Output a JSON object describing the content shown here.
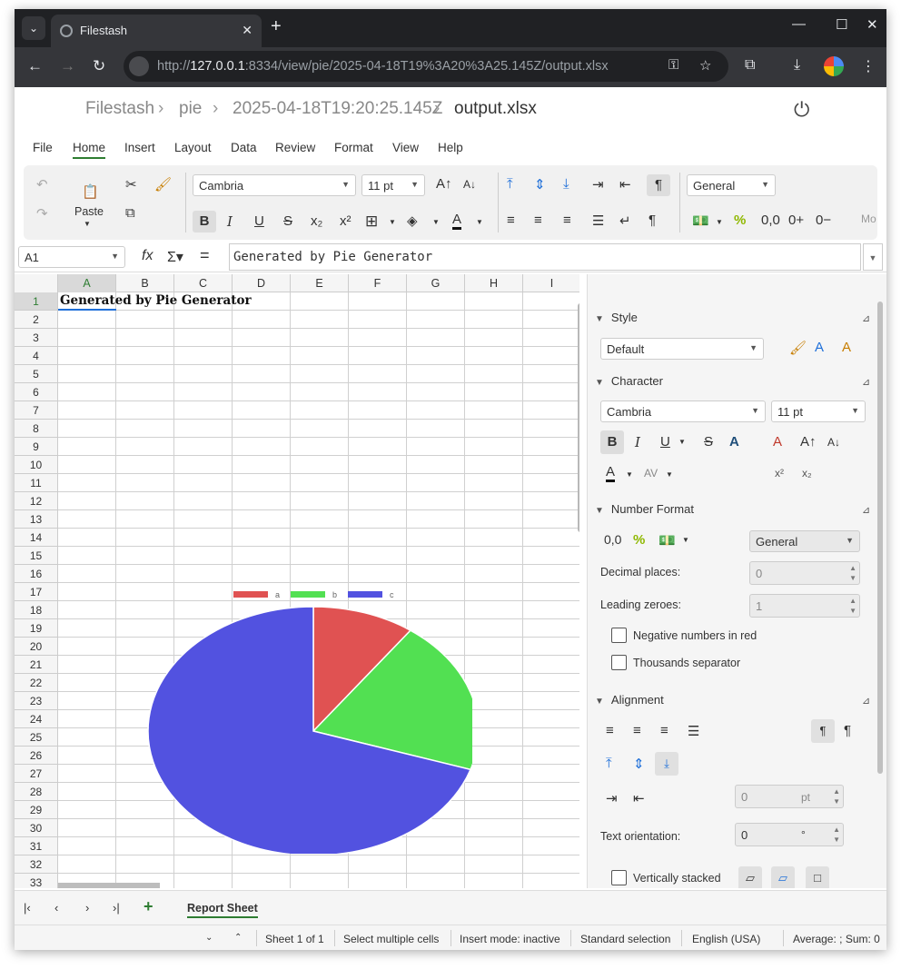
{
  "browser": {
    "tab_title": "Filestash",
    "url_prefix": "http://",
    "url_host": "127.0.0.1",
    "url_rest": ":8334/view/pie/2025-04-18T19%3A20%3A25.145Z/output.xlsx"
  },
  "breadcrumb": [
    "Filestash",
    "pie",
    "2025-04-18T19:20:25.145Z",
    "output.xlsx"
  ],
  "menu": [
    "File",
    "Home",
    "Insert",
    "Layout",
    "Data",
    "Review",
    "Format",
    "View",
    "Help"
  ],
  "toolbar": {
    "paste_label": "Paste",
    "font_name": "Cambria",
    "font_size": "11 pt",
    "number_format": "General",
    "more_label": "Mo"
  },
  "formula_bar": {
    "cell_ref": "A1",
    "formula": "Generated by Pie Generator"
  },
  "sheet": {
    "columns": [
      "A",
      "B",
      "C",
      "D",
      "E",
      "F",
      "G",
      "H",
      "I"
    ],
    "rows": [
      "1",
      "2",
      "3",
      "4",
      "5",
      "6",
      "7",
      "8",
      "9",
      "10",
      "11",
      "12",
      "13",
      "14",
      "15",
      "16",
      "17",
      "18",
      "19",
      "20",
      "21",
      "22",
      "23",
      "24",
      "25",
      "26",
      "27",
      "28",
      "29",
      "30",
      "31",
      "32",
      "33"
    ],
    "a1_text": "Generated by Pie Generator"
  },
  "chart_data": {
    "type": "pie",
    "categories": [
      "a",
      "b",
      "c"
    ],
    "values": [
      10,
      20,
      70
    ],
    "colors": [
      "#e05252",
      "#52e052",
      "#5252e0"
    ],
    "legend": "top"
  },
  "sidebar": {
    "style": {
      "title": "Style",
      "value": "Default"
    },
    "character": {
      "title": "Character",
      "font": "Cambria",
      "size": "11 pt"
    },
    "number_format": {
      "title": "Number Format",
      "format": "General",
      "decimal_label": "Decimal places:",
      "decimal_value": "0",
      "leading_label": "Leading zeroes:",
      "leading_value": "1",
      "neg_red_label": "Negative numbers in red",
      "thousands_label": "Thousands separator"
    },
    "alignment": {
      "title": "Alignment",
      "indent_value": "0",
      "indent_unit": "pt",
      "orientation_label": "Text orientation:",
      "orientation_value": "0",
      "orientation_unit": "°",
      "vstack_label": "Vertically stacked"
    }
  },
  "sheet_tabs": {
    "active": "Report Sheet"
  },
  "status": {
    "sheet": "Sheet 1 of 1",
    "select": "Select multiple cells",
    "insert": "Insert mode: inactive",
    "selection": "Standard selection",
    "lang": "English (USA)",
    "summary": "Average: ; Sum: 0"
  }
}
